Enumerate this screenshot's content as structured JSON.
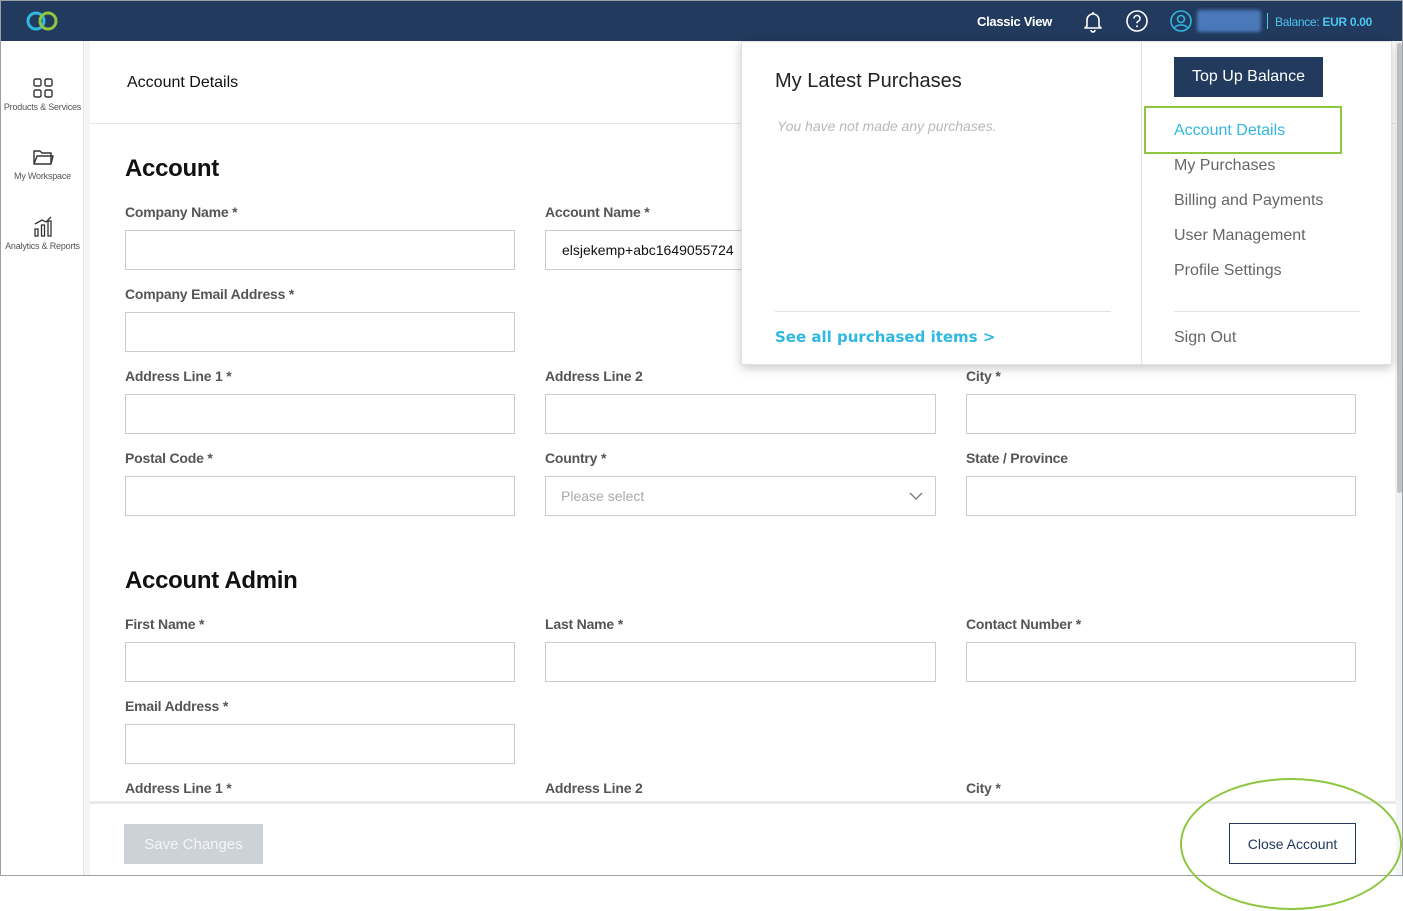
{
  "topbar": {
    "classic_view": "Classic View",
    "balance_label": "Balance:",
    "balance_value": "EUR 0.00"
  },
  "sidebar": {
    "items": [
      {
        "label": "Products & Services",
        "icon": "grid-icon"
      },
      {
        "label": "My Workspace",
        "icon": "folder-icon"
      },
      {
        "label": "Analytics & Reports",
        "icon": "chart-icon"
      }
    ]
  },
  "main": {
    "page_title": "Account Details",
    "account_section": {
      "heading": "Account",
      "fields": {
        "company_name_label": "Company Name *",
        "account_name_label": "Account Name *",
        "account_name_value": "elsjekemp+abc1649055724",
        "company_email_label": "Company Email Address *",
        "address1_label": "Address Line 1 *",
        "address2_label": "Address Line 2",
        "city_label": "City *",
        "postal_label": "Postal Code *",
        "country_label": "Country *",
        "country_placeholder": "Please select",
        "state_label": "State / Province"
      }
    },
    "admin_section": {
      "heading": "Account Admin",
      "fields": {
        "first_name_label": "First Name *",
        "last_name_label": "Last Name *",
        "contact_label": "Contact Number *",
        "email_label": "Email Address *",
        "address1_label": "Address Line 1 *",
        "address2_label": "Address Line 2",
        "city_label": "City *"
      }
    }
  },
  "footer": {
    "save_label": "Save Changes",
    "close_label": "Close Account"
  },
  "dropdown": {
    "purchases_title": "My Latest Purchases",
    "empty_text": "You have not made any purchases.",
    "see_all": "See all purchased items >",
    "topup_label": "Top Up Balance",
    "menu": [
      "Account Details",
      "My Purchases",
      "Billing and Payments",
      "User Management",
      "Profile Settings"
    ],
    "sign_out": "Sign Out"
  },
  "colors": {
    "navy": "#223a5e",
    "accent": "#2fb8e0",
    "highlight": "#8dc63f"
  }
}
